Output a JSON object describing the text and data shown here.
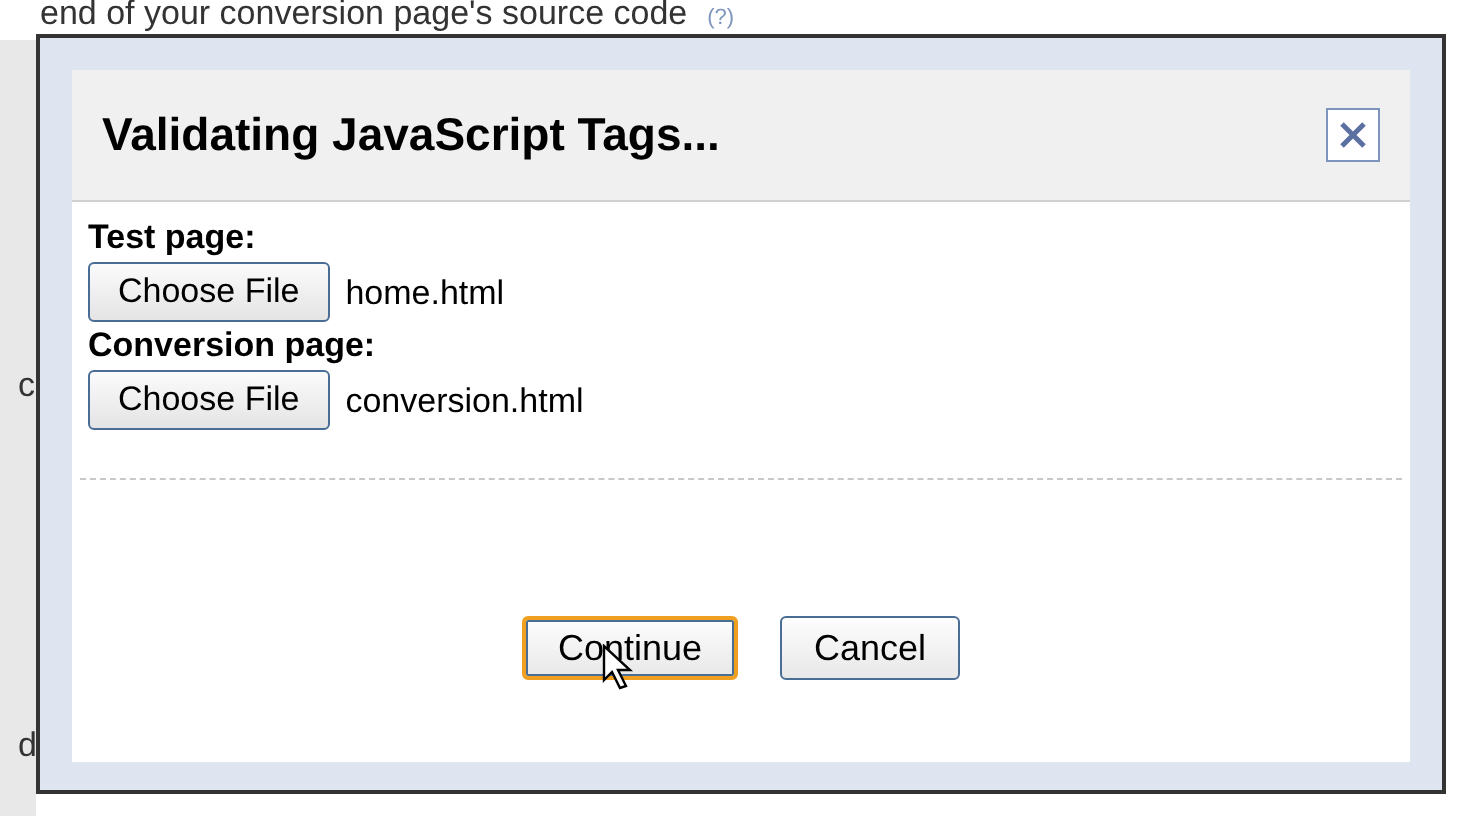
{
  "page": {
    "source_text": "end of your conversion page's source code",
    "help_link": "(?)",
    "fragments": [
      "c",
      "d"
    ]
  },
  "dialog": {
    "title": "Validating JavaScript Tags...",
    "fields": [
      {
        "label": "Test page:",
        "button": "Choose File",
        "file": "home.html"
      },
      {
        "label": "Conversion page:",
        "button": "Choose File",
        "file": "conversion.html"
      }
    ],
    "buttons": [
      {
        "label": "Continue",
        "focused": true
      },
      {
        "label": "Cancel",
        "focused": false
      }
    ]
  }
}
